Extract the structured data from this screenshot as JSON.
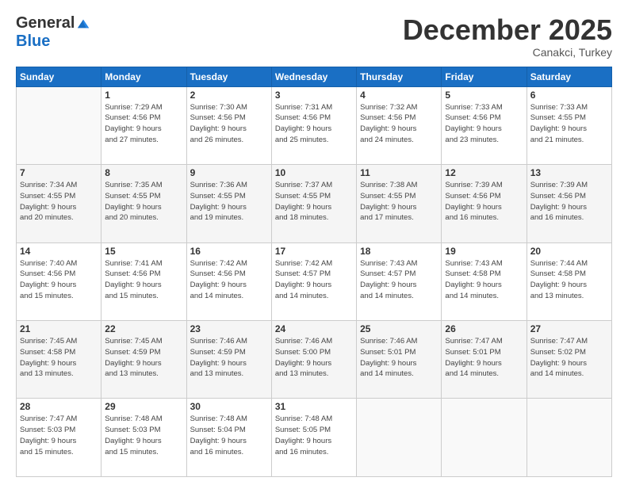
{
  "logo": {
    "general": "General",
    "blue": "Blue"
  },
  "title": "December 2025",
  "location": "Canakci, Turkey",
  "days_of_week": [
    "Sunday",
    "Monday",
    "Tuesday",
    "Wednesday",
    "Thursday",
    "Friday",
    "Saturday"
  ],
  "weeks": [
    [
      {
        "day": "",
        "info": ""
      },
      {
        "day": "1",
        "info": "Sunrise: 7:29 AM\nSunset: 4:56 PM\nDaylight: 9 hours\nand 27 minutes."
      },
      {
        "day": "2",
        "info": "Sunrise: 7:30 AM\nSunset: 4:56 PM\nDaylight: 9 hours\nand 26 minutes."
      },
      {
        "day": "3",
        "info": "Sunrise: 7:31 AM\nSunset: 4:56 PM\nDaylight: 9 hours\nand 25 minutes."
      },
      {
        "day": "4",
        "info": "Sunrise: 7:32 AM\nSunset: 4:56 PM\nDaylight: 9 hours\nand 24 minutes."
      },
      {
        "day": "5",
        "info": "Sunrise: 7:33 AM\nSunset: 4:56 PM\nDaylight: 9 hours\nand 23 minutes."
      },
      {
        "day": "6",
        "info": "Sunrise: 7:33 AM\nSunset: 4:55 PM\nDaylight: 9 hours\nand 21 minutes."
      }
    ],
    [
      {
        "day": "7",
        "info": "Sunrise: 7:34 AM\nSunset: 4:55 PM\nDaylight: 9 hours\nand 20 minutes."
      },
      {
        "day": "8",
        "info": "Sunrise: 7:35 AM\nSunset: 4:55 PM\nDaylight: 9 hours\nand 20 minutes."
      },
      {
        "day": "9",
        "info": "Sunrise: 7:36 AM\nSunset: 4:55 PM\nDaylight: 9 hours\nand 19 minutes."
      },
      {
        "day": "10",
        "info": "Sunrise: 7:37 AM\nSunset: 4:55 PM\nDaylight: 9 hours\nand 18 minutes."
      },
      {
        "day": "11",
        "info": "Sunrise: 7:38 AM\nSunset: 4:55 PM\nDaylight: 9 hours\nand 17 minutes."
      },
      {
        "day": "12",
        "info": "Sunrise: 7:39 AM\nSunset: 4:56 PM\nDaylight: 9 hours\nand 16 minutes."
      },
      {
        "day": "13",
        "info": "Sunrise: 7:39 AM\nSunset: 4:56 PM\nDaylight: 9 hours\nand 16 minutes."
      }
    ],
    [
      {
        "day": "14",
        "info": "Sunrise: 7:40 AM\nSunset: 4:56 PM\nDaylight: 9 hours\nand 15 minutes."
      },
      {
        "day": "15",
        "info": "Sunrise: 7:41 AM\nSunset: 4:56 PM\nDaylight: 9 hours\nand 15 minutes."
      },
      {
        "day": "16",
        "info": "Sunrise: 7:42 AM\nSunset: 4:56 PM\nDaylight: 9 hours\nand 14 minutes."
      },
      {
        "day": "17",
        "info": "Sunrise: 7:42 AM\nSunset: 4:57 PM\nDaylight: 9 hours\nand 14 minutes."
      },
      {
        "day": "18",
        "info": "Sunrise: 7:43 AM\nSunset: 4:57 PM\nDaylight: 9 hours\nand 14 minutes."
      },
      {
        "day": "19",
        "info": "Sunrise: 7:43 AM\nSunset: 4:58 PM\nDaylight: 9 hours\nand 14 minutes."
      },
      {
        "day": "20",
        "info": "Sunrise: 7:44 AM\nSunset: 4:58 PM\nDaylight: 9 hours\nand 13 minutes."
      }
    ],
    [
      {
        "day": "21",
        "info": "Sunrise: 7:45 AM\nSunset: 4:58 PM\nDaylight: 9 hours\nand 13 minutes."
      },
      {
        "day": "22",
        "info": "Sunrise: 7:45 AM\nSunset: 4:59 PM\nDaylight: 9 hours\nand 13 minutes."
      },
      {
        "day": "23",
        "info": "Sunrise: 7:46 AM\nSunset: 4:59 PM\nDaylight: 9 hours\nand 13 minutes."
      },
      {
        "day": "24",
        "info": "Sunrise: 7:46 AM\nSunset: 5:00 PM\nDaylight: 9 hours\nand 13 minutes."
      },
      {
        "day": "25",
        "info": "Sunrise: 7:46 AM\nSunset: 5:01 PM\nDaylight: 9 hours\nand 14 minutes."
      },
      {
        "day": "26",
        "info": "Sunrise: 7:47 AM\nSunset: 5:01 PM\nDaylight: 9 hours\nand 14 minutes."
      },
      {
        "day": "27",
        "info": "Sunrise: 7:47 AM\nSunset: 5:02 PM\nDaylight: 9 hours\nand 14 minutes."
      }
    ],
    [
      {
        "day": "28",
        "info": "Sunrise: 7:47 AM\nSunset: 5:03 PM\nDaylight: 9 hours\nand 15 minutes."
      },
      {
        "day": "29",
        "info": "Sunrise: 7:48 AM\nSunset: 5:03 PM\nDaylight: 9 hours\nand 15 minutes."
      },
      {
        "day": "30",
        "info": "Sunrise: 7:48 AM\nSunset: 5:04 PM\nDaylight: 9 hours\nand 16 minutes."
      },
      {
        "day": "31",
        "info": "Sunrise: 7:48 AM\nSunset: 5:05 PM\nDaylight: 9 hours\nand 16 minutes."
      },
      {
        "day": "",
        "info": ""
      },
      {
        "day": "",
        "info": ""
      },
      {
        "day": "",
        "info": ""
      }
    ]
  ]
}
